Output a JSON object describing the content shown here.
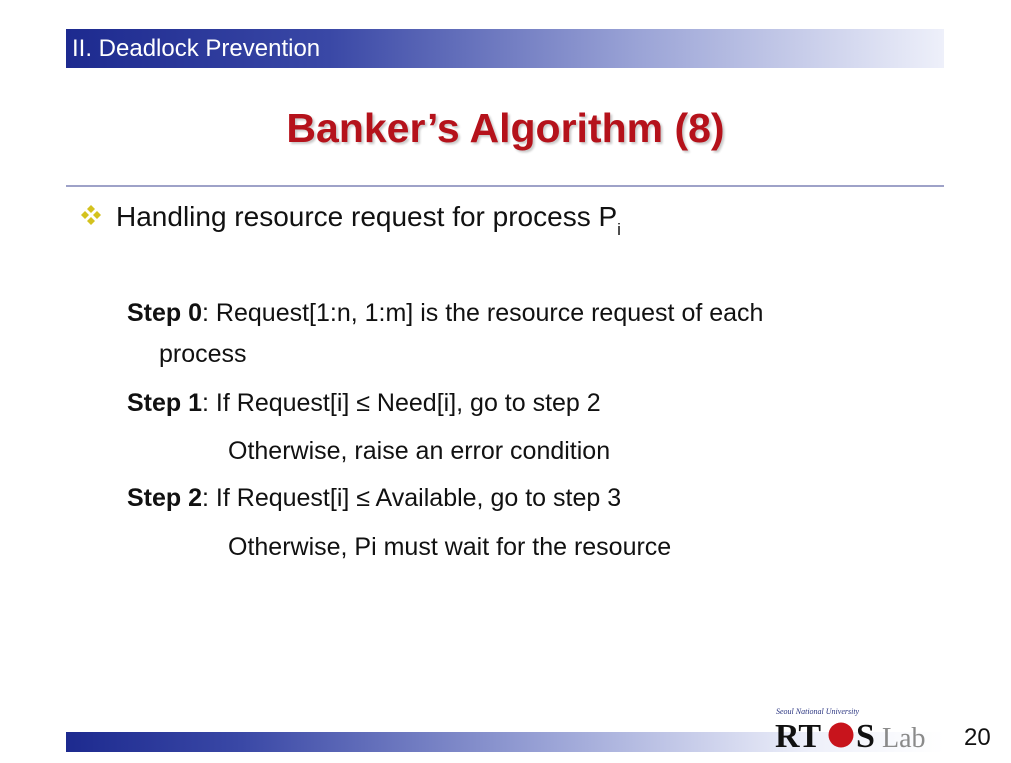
{
  "header": {
    "section": "II. Deadlock Prevention"
  },
  "slide": {
    "title": "Banker’s Algorithm (8)",
    "bullet": {
      "icon": "diamond-cluster-bullet-icon",
      "text": "Handling resource request for process P",
      "subscript": "i"
    },
    "steps": [
      {
        "label": "Step 0",
        "text": ": Request[1:n, 1:m] is the resource request of each",
        "continuation": "process"
      },
      {
        "label": "Step 1",
        "text": ": If Request[i] ≤ Need[i], go to step 2",
        "continuation": "Otherwise, raise an error condition"
      },
      {
        "label": "Step 2",
        "text": ": If Request[i] ≤ Available, go to step 3",
        "continuation": "Otherwise, Pi must wait for the resource"
      }
    ]
  },
  "footer": {
    "logo": {
      "university": "Seoul National University",
      "name_part1": "RT",
      "name_part2": "S",
      "lab": "Lab"
    },
    "page_number": "20"
  },
  "colors": {
    "title": "#b5121b",
    "header_bar_start": "#1d2a8f",
    "bullet_icon": "#d4c21e"
  }
}
